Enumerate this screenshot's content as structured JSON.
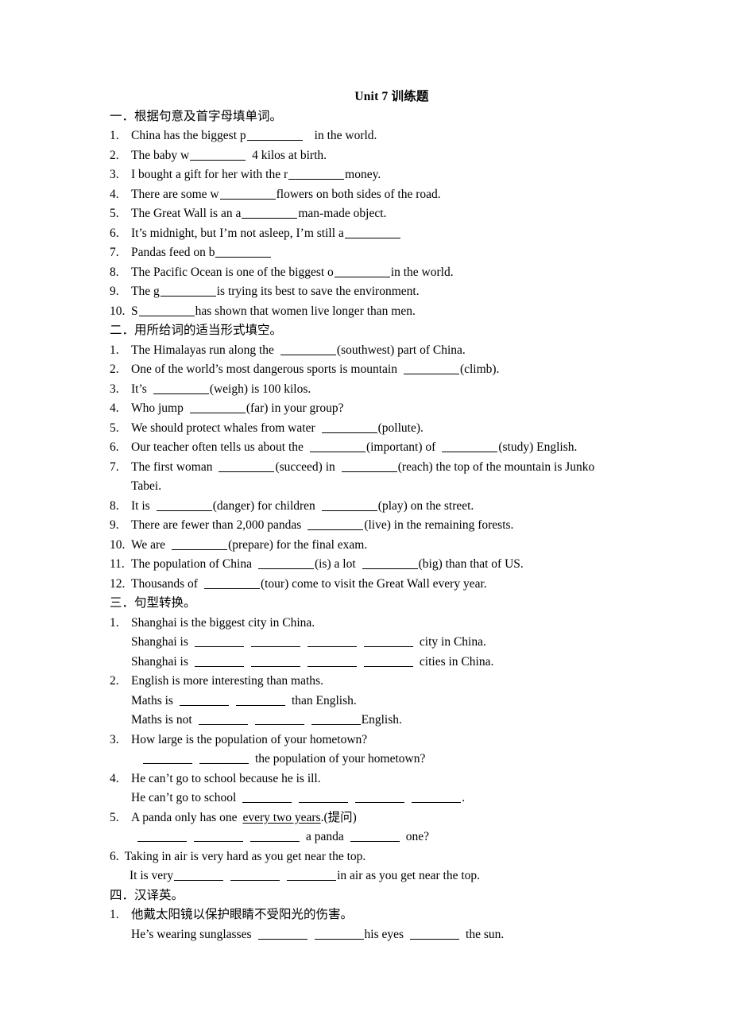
{
  "document": {
    "title": "Unit 7  训练题"
  },
  "sections": [
    {
      "heading": "一．根据句意及首字母填单词。",
      "items": [
        {
          "num": "1.",
          "text_before": "China has the biggest p",
          "text_after": "in the world."
        },
        {
          "num": "2.",
          "text_before": "The baby w",
          "text_after": "4 kilos at birth."
        },
        {
          "num": "3.",
          "text_before": "I bought a gift for her with the r",
          "text_after": "money."
        },
        {
          "num": "4.",
          "text_before": "There are some w",
          "text_after": "flowers on both sides of the road."
        },
        {
          "num": "5.",
          "text_before": "The Great Wall is an a",
          "text_after": "man-made object."
        },
        {
          "num": "6.",
          "text_before": "It’s midnight, but I’m not asleep, I’m still a",
          "text_after": ""
        },
        {
          "num": "7.",
          "text_before": "Pandas feed on b",
          "text_after": ""
        },
        {
          "num": "8.",
          "text_before": "The Pacific Ocean is one of the biggest o",
          "text_after": "in the world."
        },
        {
          "num": "9.",
          "text_before": "The g",
          "text_after": "is trying its best to save the environment."
        },
        {
          "num": "10.",
          "text_before": "S",
          "text_after": "has shown that women live longer than men."
        }
      ]
    },
    {
      "heading": "二．用所给词的适当形式填空。",
      "items": [
        {
          "num": "1.",
          "p1": "The Himalayas run along the",
          "p2": "(southwest) part of China."
        },
        {
          "num": "2.",
          "p1": "One of the world’s most dangerous sports is mountain",
          "p2": "(climb)."
        },
        {
          "num": "3.",
          "p1": "It’s",
          "p2": "(weigh) is 100 kilos."
        },
        {
          "num": "4.",
          "p1": "Who jump",
          "p2": "(far) in your group?"
        },
        {
          "num": "5.",
          "p1": "We should protect whales from water",
          "p2": "(pollute)."
        },
        {
          "num": "6.",
          "p1": "Our teacher often tells us about the",
          "p2": "(important) of",
          "p3": "(study) English."
        },
        {
          "num": "7.",
          "p1": "The first woman",
          "p2": "(succeed) in",
          "p3": "(reach) the top of the mountain is Junko",
          "p4": "Tabei."
        },
        {
          "num": "8.",
          "p1": "It is",
          "p2": "(danger) for children",
          "p3": "(play) on the street."
        },
        {
          "num": "9.",
          "p1": "There are fewer than 2,000 pandas",
          "p2": "(live) in the remaining forests."
        },
        {
          "num": "10.",
          "p1": "We are",
          "p2": "(prepare) for the final exam."
        },
        {
          "num": "11.",
          "p1": "The population of China",
          "p2": "(is) a lot",
          "p3": "(big) than that of US."
        },
        {
          "num": "12.",
          "p1": "Thousands of",
          "p2": "(tour) come to visit the Great Wall every year."
        }
      ]
    },
    {
      "heading": "三．句型转换。",
      "items": [
        {
          "num": "1.",
          "prompt": "Shanghai is the biggest city in China.",
          "answer_1_before": "Shanghai is",
          "answer_1_after": "city in China.",
          "answer_2_before": "Shanghai is",
          "answer_2_after": "cities in China."
        },
        {
          "num": "2.",
          "prompt": "English is more interesting than maths.",
          "answer_1_before": "Maths is",
          "answer_1_after": "than English.",
          "answer_2_before": "Maths is not",
          "answer_2_after": "English."
        },
        {
          "num": "3.",
          "prompt": "How large is the population of your hometown?",
          "answer_1_before": "",
          "answer_1_after": "the population of your hometown?"
        },
        {
          "num": "4.",
          "prompt": "He can’t go to school because he is ill.",
          "answer_1_before": "He can’t go to school",
          "answer_1_after": "."
        },
        {
          "num": "5.",
          "prompt_before": "A panda only has one",
          "prompt_underline": "every two years",
          "prompt_after": ".(提问)",
          "answer_1_before": "",
          "answer_1_mid": "a panda",
          "answer_1_after": "one?"
        },
        {
          "num": "6.",
          "prompt": "Taking in air is very hard as you get near the top.",
          "answer_1_before": "It is very",
          "answer_1_after": "in air as you get near the top."
        }
      ]
    },
    {
      "heading": "四．汉译英。",
      "items": [
        {
          "num": "1.",
          "prompt": "他戴太阳镜以保护眼睛不受阳光的伤害。",
          "answer_1_before": "He’s wearing sunglasses",
          "answer_1_mid": "his eyes",
          "answer_1_after": "the sun."
        }
      ]
    }
  ]
}
